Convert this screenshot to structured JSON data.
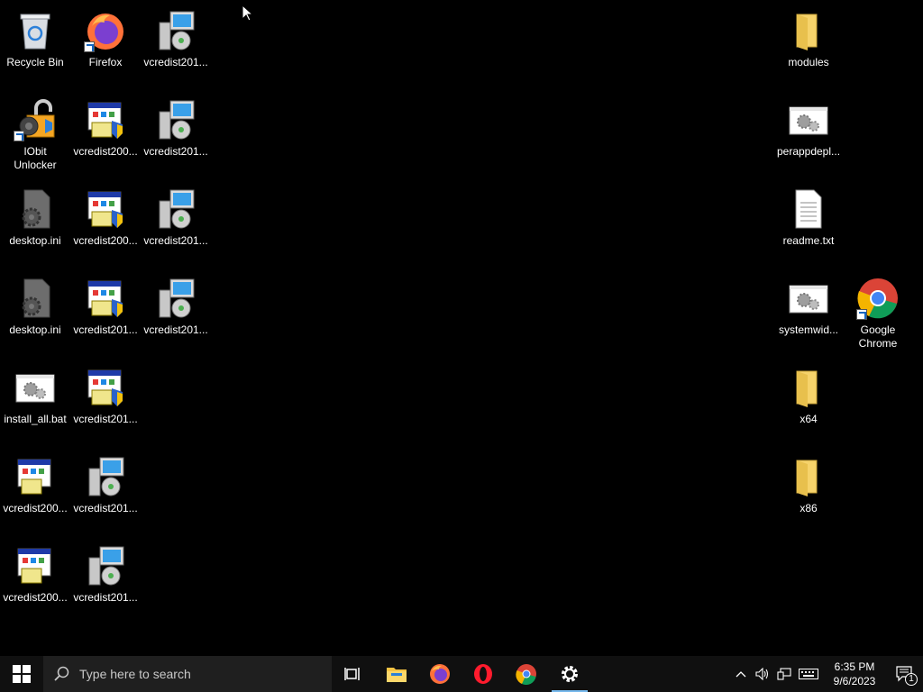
{
  "desktop_icons": [
    {
      "label": "Recycle Bin",
      "type": "recycle-bin"
    },
    {
      "label": "Firefox",
      "type": "firefox"
    },
    {
      "label": "vcredist201...",
      "type": "installer-monitor"
    },
    {
      "label": "IObit Unlocker",
      "type": "iobit-unlocker"
    },
    {
      "label": "vcredist200...",
      "type": "installer-window"
    },
    {
      "label": "vcredist201...",
      "type": "installer-monitor"
    },
    {
      "label": "desktop.ini",
      "type": "settings-file"
    },
    {
      "label": "vcredist200...",
      "type": "installer-window"
    },
    {
      "label": "vcredist201...",
      "type": "installer-monitor"
    },
    {
      "label": "desktop.ini",
      "type": "settings-file"
    },
    {
      "label": "vcredist201...",
      "type": "installer-window"
    },
    {
      "label": "vcredist201...",
      "type": "installer-monitor"
    },
    {
      "label": "install_all.bat",
      "type": "batch-file"
    },
    {
      "label": "vcredist201...",
      "type": "installer-window"
    },
    {
      "label": "vcredist200...",
      "type": "installer-window"
    },
    {
      "label": "vcredist201...",
      "type": "installer-monitor"
    },
    {
      "label": "vcredist200...",
      "type": "installer-window"
    },
    {
      "label": "vcredist201...",
      "type": "installer-monitor"
    },
    {
      "label": "modules",
      "type": "folder"
    },
    {
      "label": "perappdepl...",
      "type": "batch-file"
    },
    {
      "label": "readme.txt",
      "type": "text-file"
    },
    {
      "label": "systemwid...",
      "type": "batch-file"
    },
    {
      "label": "Google Chrome",
      "type": "chrome"
    },
    {
      "label": "x64",
      "type": "folder"
    },
    {
      "label": "x86",
      "type": "folder"
    }
  ],
  "taskbar": {
    "search_placeholder": "Type here to search",
    "pinned": [
      "task-view",
      "file-explorer",
      "firefox",
      "opera",
      "chrome",
      "settings"
    ],
    "active": "settings",
    "time": "6:35 PM",
    "date": "9/6/2023",
    "notification_count": "1"
  },
  "colors": {
    "taskbar_bg": "#101010",
    "search_bg": "#1f1f1f",
    "active_indicator": "#76b9ed",
    "folder_yellow": "#f6d36b"
  }
}
